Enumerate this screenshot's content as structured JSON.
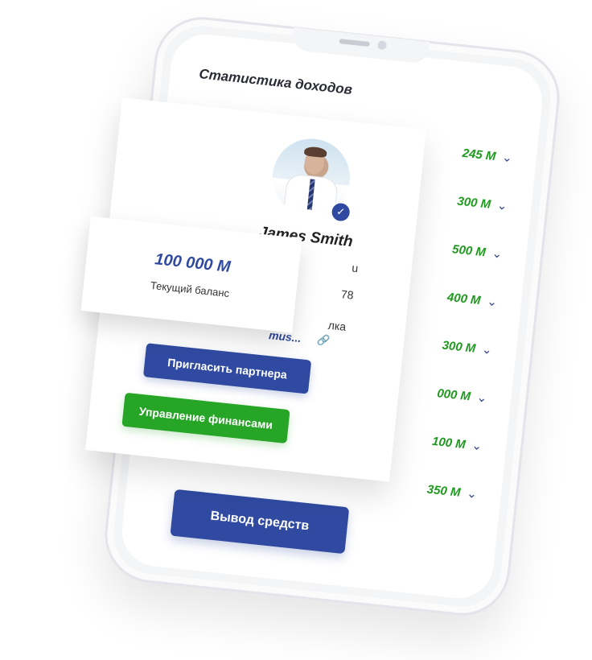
{
  "stats": {
    "title": "Статистика доходов",
    "rows": [
      {
        "value": "245 M"
      },
      {
        "value": "300 M"
      },
      {
        "value": "500 M"
      },
      {
        "value": "400 M"
      },
      {
        "value": "300 M"
      },
      {
        "value": "000 M"
      },
      {
        "value": "100 M"
      },
      {
        "value": "350 M"
      }
    ],
    "chevron": "⌄"
  },
  "withdraw": {
    "label": "Вывод средств"
  },
  "profile": {
    "name": "James Smith",
    "partial_right_1": "u",
    "partial_right_2": "78",
    "partial_right_3": "лка",
    "ref_link": "mus...",
    "link_icon": "link-icon",
    "verified_icon": "check-icon",
    "invite_label": "Пригласить партнера",
    "finance_label": "Управление финансами"
  },
  "balance": {
    "amount": "100 000 M",
    "label": "Текущий баланс"
  },
  "colors": {
    "primary": "#2f4aa0",
    "success": "#26a526",
    "stat_green": "#1f9a1f"
  }
}
